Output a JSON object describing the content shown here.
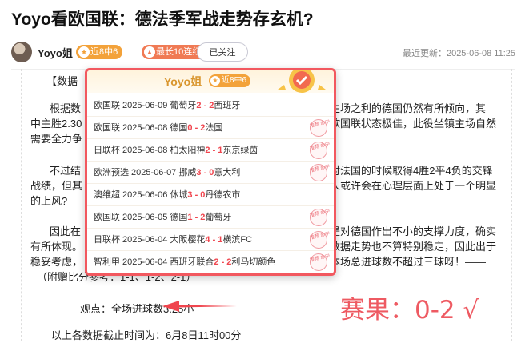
{
  "article": {
    "title": "Yoyo看欧国联：德法季军战走势存玄机?",
    "author": "Yoyo姐",
    "badge_recent": "近8中6",
    "badge_streak": "最长10连红",
    "follow_label": "已关注",
    "updated": "最近更新：2025-06-08 11:25",
    "paragraphs": [
      "【数据",
      "根据数",
      "主场之利的德国仍然有所倾向，其",
      "中主胜2.30",
      "欧国联状态极佳，此役坐镇主场自然",
      "需要全力争",
      "不过结",
      "对法国的时候取得4胜2平4负的交锋",
      "战绩，但其",
      "人或许会在心理层面上处于一个明显",
      "的上风?",
      "因此在",
      "是对德国作出不小的支撑力度，确实",
      "有所体现。",
      "数据走势也不算特别稳定，因此出于",
      "稳妥考虑，",
      "本场总进球数不超过三球呀！——",
      "（附赠比分参考：1-1、1-2、2-1）",
      "以上各数据截止时间为：6月8日11时00分"
    ],
    "viewpoint": "观点：全场进球数3.25小",
    "result_annotation": "赛果：0-2 √"
  },
  "popup": {
    "title": "Yoyo姐",
    "badge": "近8中6",
    "stamp_text": "推荐 命中",
    "matches": [
      {
        "prefix": "欧国联 2025-06-09 葡萄牙",
        "score": "2 - 2",
        "away": "西班牙",
        "hit": false
      },
      {
        "prefix": "欧国联 2025-06-08 德国",
        "score": "0 - 2",
        "away": "法国",
        "hit": true
      },
      {
        "prefix": "日联杯 2025-06-08 柏太阳神",
        "score": "2 - 1",
        "away": "东京绿茵",
        "hit": true
      },
      {
        "prefix": "欧洲预选 2025-06-07 挪威",
        "score": "3 - 0",
        "away": "意大利",
        "hit": true
      },
      {
        "prefix": "澳维超 2025-06-06 休城",
        "score": "3 - 0",
        "away": "丹德农市",
        "hit": false
      },
      {
        "prefix": "欧国联 2025-06-05 德国",
        "score": "1 - 2",
        "away": "葡萄牙",
        "hit": true
      },
      {
        "prefix": "日联杯 2025-06-04 大阪樱花",
        "score": "4 - 1",
        "away": "横滨FC",
        "hit": true
      },
      {
        "prefix": "智利甲 2025-06-04 西班牙联合",
        "score": "2 - 2",
        "away": "利马切颜色",
        "hit": true
      }
    ]
  },
  "colors": {
    "accent_red": "#f2585f",
    "badge_orange": "#f3a23a",
    "badge_red": "#f07a54"
  },
  "icons": [
    "avatar",
    "star-icon",
    "flame-icon",
    "medal-icon",
    "hit-stamp-icon",
    "arrow-icon"
  ]
}
